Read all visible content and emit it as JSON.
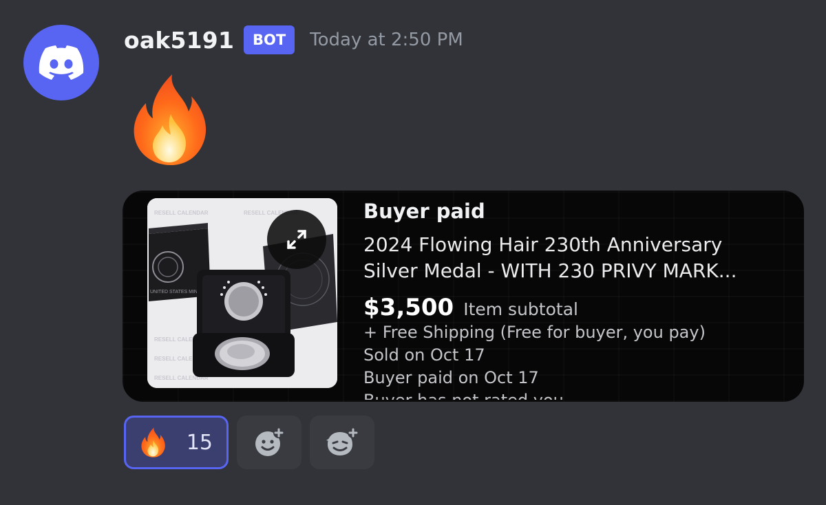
{
  "message": {
    "author": "oak5191",
    "badge": "BOT",
    "timestamp": "Today at 2:50 PM",
    "content_emoji": "fire"
  },
  "embed": {
    "title": "Buyer paid",
    "item_name_line1": "2024 Flowing Hair 230th Anniversary",
    "item_name_line2": "Silver Medal - WITH 230 PRIVY MARK...",
    "price": "$3,500",
    "price_label": "Item subtotal",
    "details": [
      "+ Free Shipping (Free for buyer, you pay)",
      "Sold on Oct 17",
      "Buyer paid on Oct 17",
      "Buyer has not rated you"
    ],
    "thumbnail_watermark": "RESELL CALENDAR",
    "thumbnail_box_text": "UNITED STATES MINT"
  },
  "reactions": [
    {
      "emoji": "fire",
      "count": "15",
      "active": true
    }
  ],
  "actions": {
    "add_reaction_icon": "add-reaction-icon",
    "add_super_reaction_icon": "add-super-reaction-icon"
  },
  "colors": {
    "background": "#313338",
    "brand": "#5865f2",
    "embed_bg": "#070708"
  }
}
